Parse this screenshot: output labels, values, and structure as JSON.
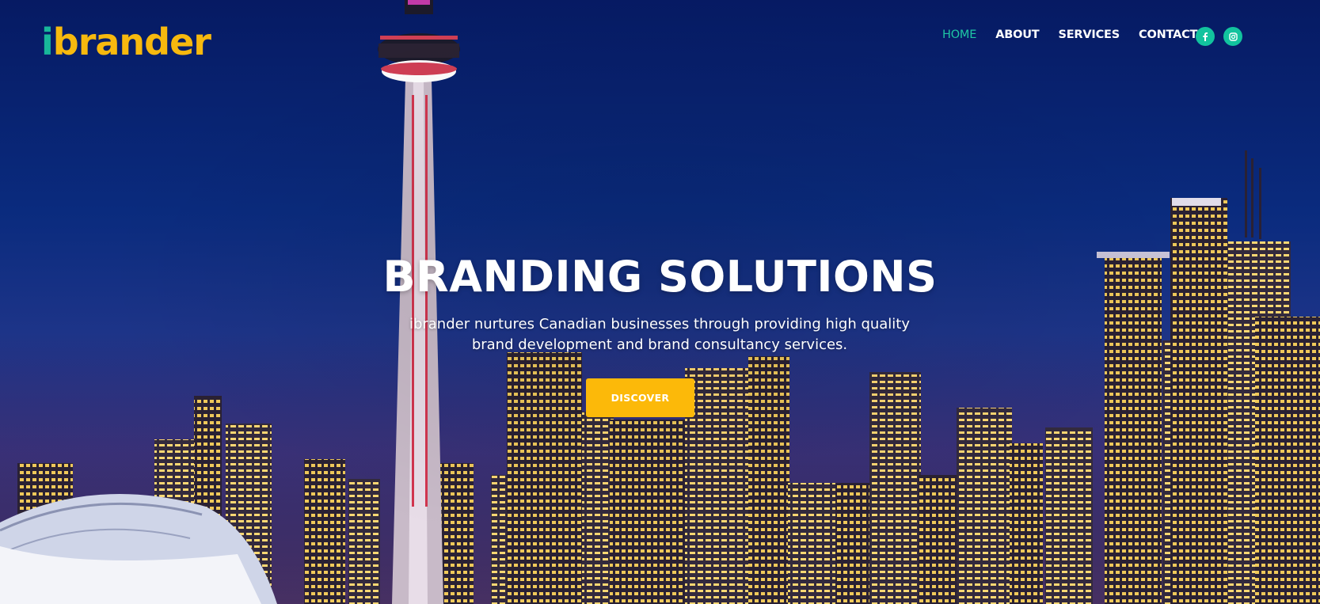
{
  "brand": {
    "logo_text_i": "i",
    "logo_text_rest": "brander",
    "colors": {
      "teal": "#18b79a",
      "yellow": "#f7b90e"
    }
  },
  "nav": {
    "items": [
      {
        "label": "HOME",
        "active": true
      },
      {
        "label": "ABOUT",
        "active": false
      },
      {
        "label": "SERVICES",
        "active": false
      },
      {
        "label": "CONTACT",
        "active": false
      }
    ],
    "active_color": "#1fc7a4"
  },
  "social": [
    {
      "icon": "facebook-icon",
      "glyph": "f"
    },
    {
      "icon": "instagram-icon",
      "glyph": ""
    }
  ],
  "hero": {
    "headline": "BRANDING SOLUTIONS",
    "subtext_line1": "ibrander nurtures Canadian businesses through providing high quality",
    "subtext_line2": "brand development and brand consultancy services.",
    "cta_label": "DISCOVER",
    "cta_color": "#fcb909"
  }
}
